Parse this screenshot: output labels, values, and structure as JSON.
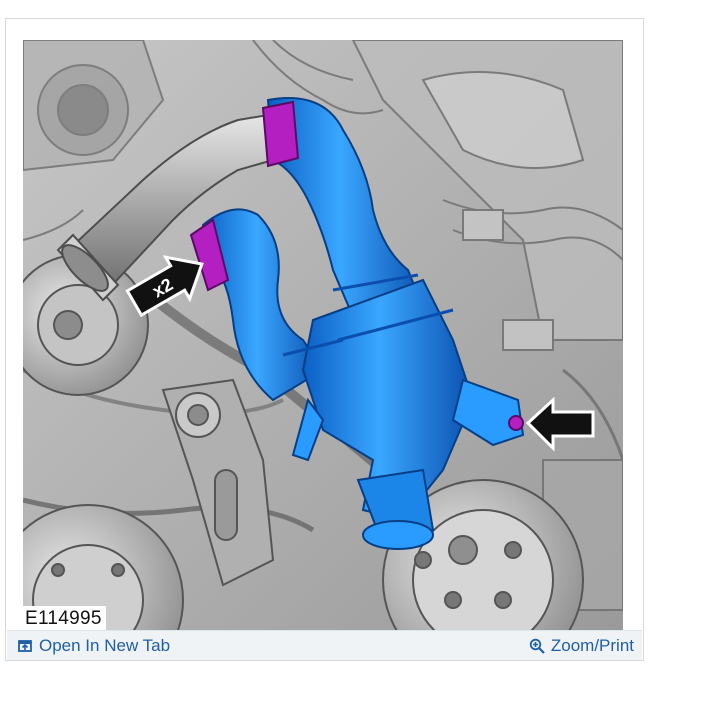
{
  "figure": {
    "id_label": "E114995",
    "callout_text": "x2"
  },
  "toolbar": {
    "open_new_tab_label": "Open In New Tab",
    "open_new_tab_icon": "open-new-tab-icon",
    "zoom_print_label": "Zoom/Print",
    "zoom_print_icon": "zoom-in-icon"
  },
  "colors": {
    "link": "#1f5fa8",
    "hose": "#1e8ff0",
    "clamp": "#b31fc0",
    "engine_gray": "#a9a9a9"
  }
}
